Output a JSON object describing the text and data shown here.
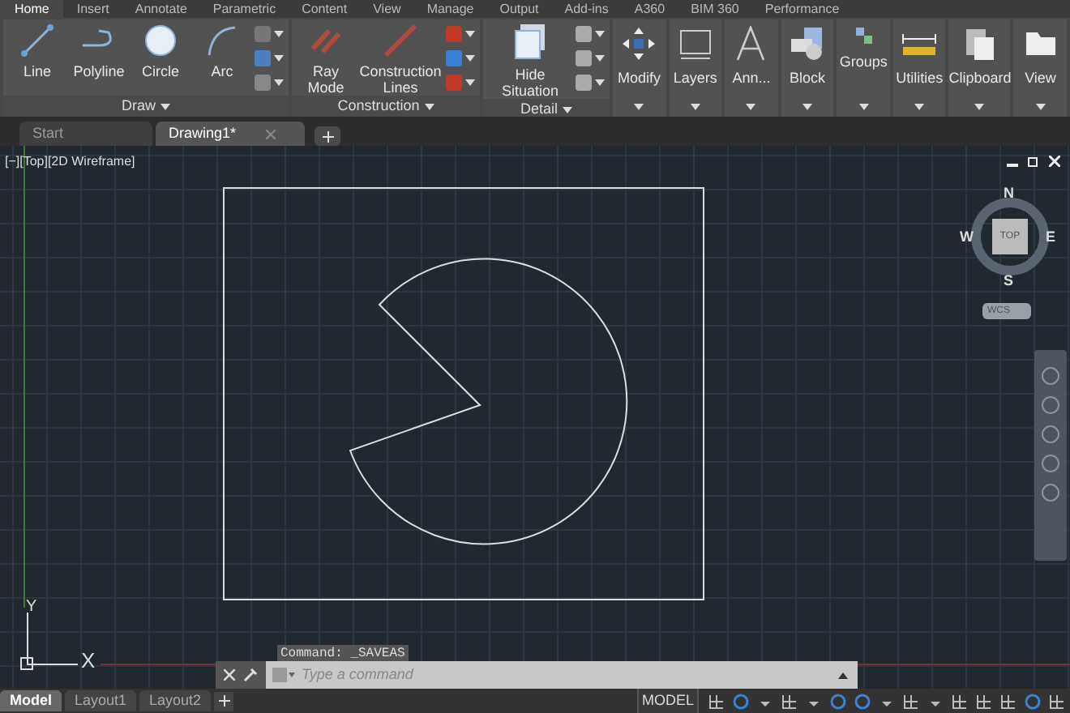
{
  "ribbon_tabs": [
    {
      "label": "Home",
      "selected": true
    },
    {
      "label": "Insert",
      "selected": false
    },
    {
      "label": "Annotate",
      "selected": false
    },
    {
      "label": "Parametric",
      "selected": false
    },
    {
      "label": "Content",
      "selected": false
    },
    {
      "label": "View",
      "selected": false
    },
    {
      "label": "Manage",
      "selected": false
    },
    {
      "label": "Output",
      "selected": false
    },
    {
      "label": "Add-ins",
      "selected": false
    },
    {
      "label": "A360",
      "selected": false
    },
    {
      "label": "BIM 360",
      "selected": false
    },
    {
      "label": "Performance",
      "selected": false
    }
  ],
  "ribbon_panels": [
    {
      "title": "Draw",
      "tools": [
        "Line",
        "Polyline",
        "Circle",
        "Arc"
      ]
    },
    {
      "title": "Construction",
      "tools": [
        "Ray Mode",
        "Construction Lines"
      ]
    },
    {
      "title": "Detail",
      "tools": [
        "Hide Situation"
      ]
    }
  ],
  "collapsed_panels": [
    "Modify",
    "Layers",
    "Ann...",
    "Block",
    "Groups",
    "Utilities",
    "Clipboard",
    "View"
  ],
  "file_tabs": [
    {
      "label": "Start",
      "selected": false
    },
    {
      "label": "Drawing1*",
      "selected": true
    }
  ],
  "viewport_label": "[−][Top][2D Wireframe]",
  "view_cube": {
    "top": "TOP",
    "north": "N",
    "south": "S",
    "east": "E",
    "west": "W",
    "wcs": "WCS"
  },
  "ucs": {
    "y": "Y",
    "x": "X"
  },
  "command_history": "Command: _SAVEAS",
  "command_input": {
    "placeholder": "Type a command"
  },
  "layout_tabs": [
    {
      "label": "Model",
      "selected": true
    },
    {
      "label": "Layout1",
      "selected": false
    },
    {
      "label": "Layout2",
      "selected": false
    }
  ],
  "status_bar": {
    "mode": "MODEL"
  }
}
